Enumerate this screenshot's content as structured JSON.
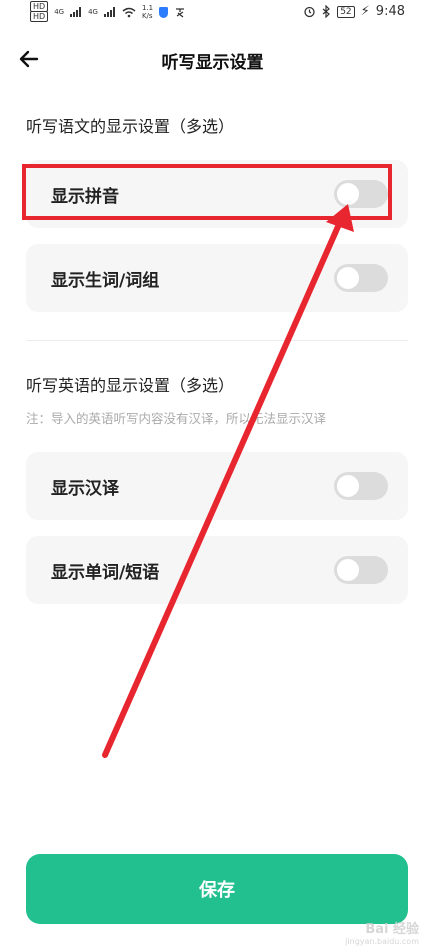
{
  "status_bar": {
    "hd1": "HD",
    "hd2": "HD",
    "signal1": "4G",
    "signal2": "4G",
    "speed_value": "1.1",
    "speed_unit": "K/s",
    "battery": "52",
    "time": "9:48"
  },
  "header": {
    "title": "听写显示设置"
  },
  "chinese_section": {
    "title": "听写语文的显示设置（多选）",
    "items": [
      {
        "label": "显示拼音",
        "enabled": false
      },
      {
        "label": "显示生词/词组",
        "enabled": false
      }
    ]
  },
  "english_section": {
    "title": "听写英语的显示设置（多选）",
    "note": "注：导入的英语听写内容没有汉译，所以无法显示汉译",
    "items": [
      {
        "label": "显示汉译",
        "enabled": false
      },
      {
        "label": "显示单词/短语",
        "enabled": false
      }
    ]
  },
  "save_button": {
    "label": "保存"
  },
  "watermark": {
    "text": "Bai 经验",
    "sub": "jingyan.baidu.com"
  },
  "colors": {
    "accent": "#22c08f",
    "annotation": "#e8262f",
    "toggle_off": "#dcdcdc",
    "card_bg": "#f6f6f6"
  },
  "icons": {
    "back": "arrow-left-icon",
    "wifi": "wifi-icon",
    "shield": "shield-icon",
    "alarm": "alarm-icon",
    "bluetooth": "bluetooth-icon"
  }
}
